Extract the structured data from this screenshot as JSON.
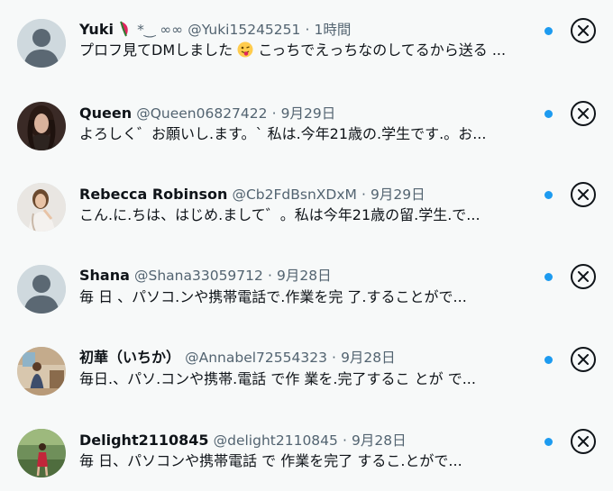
{
  "conversations": [
    {
      "name": "Yuki",
      "name_suffix": "*‿ ∞∞",
      "handle": "@Yuki15245251",
      "time": "1時間",
      "snippet_a": "プロフ見てDMしました",
      "snippet_b": " こっちでえっちなのしてるから送る ...",
      "avatar": "default"
    },
    {
      "name": "Queen",
      "handle": "@Queen06827422",
      "time": "9月29日",
      "snippet": "よろしく゛お願いし.ます。` 私は.今年21歳の.学生です.。お...",
      "avatar": "photo"
    },
    {
      "name": "Rebecca Robinson",
      "handle": "@Cb2FdBsnXDxM",
      "time": "9月29日",
      "snippet": "こん.に.ちは、はじめ.まして゛。私は今年21歳の留.学生.で...",
      "avatar": "photo"
    },
    {
      "name": "Shana",
      "handle": "@Shana33059712",
      "time": "9月28日",
      "snippet": "毎 日 、パソコ.ンや携帯電話で.作業を完 了.することがで...",
      "avatar": "default"
    },
    {
      "name": "初華（いちか）",
      "handle": "@Annabel72554323",
      "time": "9月28日",
      "snippet": "毎日.、パソ.コンや携帯.電話 で作 業を.完了するこ とが で...",
      "avatar": "photo"
    },
    {
      "name": "Delight2110845",
      "handle": "@delight2110845",
      "time": "9月28日",
      "snippet": "毎 日、パソコンや携帯電話 で 作業を完了 するこ.とがで...",
      "avatar": "photo"
    }
  ],
  "separator": "·",
  "colors": {
    "background": "#f7f9f9",
    "unread_dot": "#1d9bf0",
    "meta_text": "#536471",
    "primary_text": "#0f1419"
  }
}
